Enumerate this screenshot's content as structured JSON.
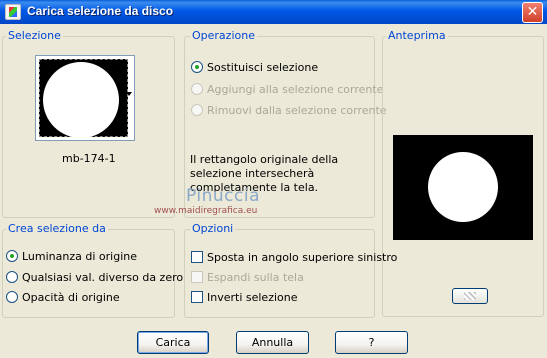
{
  "window": {
    "title": "Carica selezione da disco",
    "close_glyph": "✕"
  },
  "selezione": {
    "label": "Selezione",
    "thumbnail_name": "mb-174-1"
  },
  "operazione": {
    "label": "Operazione",
    "options": [
      {
        "label": "Sostituisci selezione",
        "selected": true,
        "enabled": true
      },
      {
        "label": "Aggiungi alla selezione corrente",
        "selected": false,
        "enabled": false
      },
      {
        "label": "Rimuovi dalla selezione corrente",
        "selected": false,
        "enabled": false
      }
    ],
    "info": "Il rettangolo originale della selezione intersecherà completamente la tela."
  },
  "watermark": {
    "name": "Pinuccia",
    "url": "www.maidiregrafica.eu"
  },
  "anteprima": {
    "label": "Anteprima"
  },
  "crea": {
    "label": "Crea selezione da",
    "options": [
      {
        "label": "Luminanza di origine",
        "selected": true
      },
      {
        "label": "Qualsiasi val. diverso da zero",
        "selected": false
      },
      {
        "label": "Opacità di origine",
        "selected": false
      }
    ]
  },
  "opzioni": {
    "label": "Opzioni",
    "items": [
      {
        "label": "Sposta in angolo superiore sinistro",
        "checked": false,
        "enabled": true
      },
      {
        "label": "Espandi sulla tela",
        "checked": false,
        "enabled": false
      },
      {
        "label": "Inverti selezione",
        "checked": false,
        "enabled": true
      }
    ]
  },
  "buttons": {
    "load": "Carica",
    "cancel": "Annulla",
    "help": "?"
  }
}
